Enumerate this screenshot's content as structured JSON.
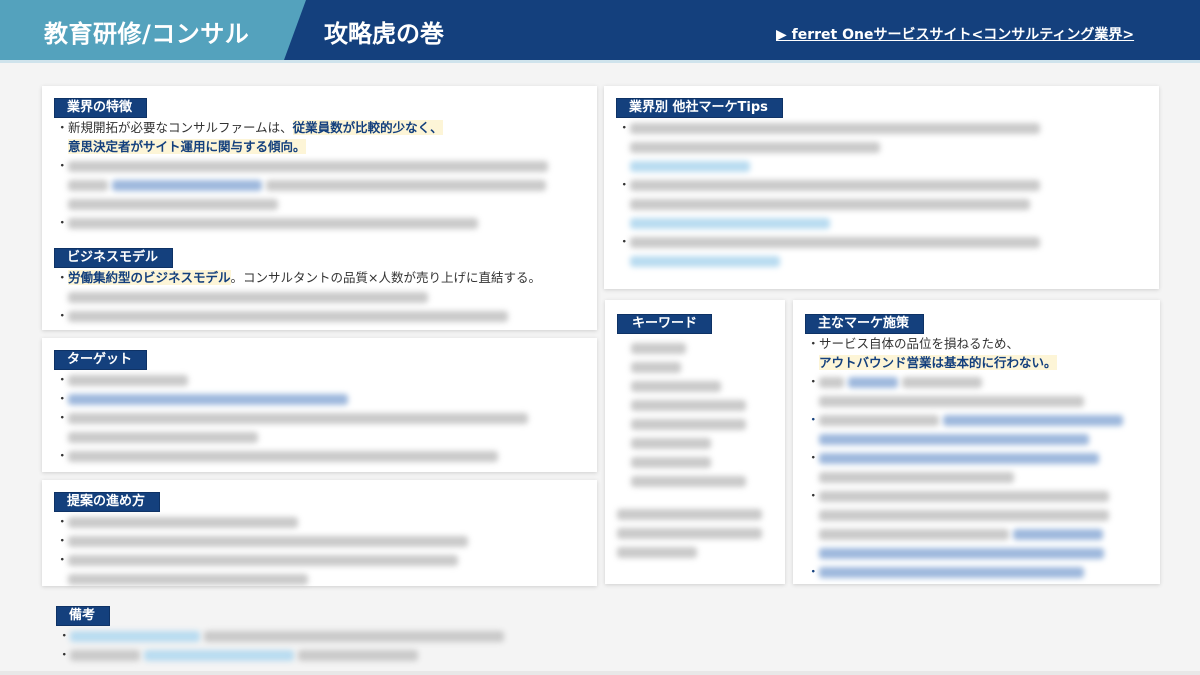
{
  "header": {
    "left_title": "教育研修/コンサル",
    "right_title": "攻略虎の巻",
    "link_label": "▶ ferret Oneサービスサイト<コンサルティング業界>"
  },
  "colors": {
    "navy": "#14407d",
    "teal": "#54a2bd",
    "highlight": "#fdf5d7"
  },
  "sections": {
    "industry": {
      "label": "業界の特徴",
      "item1_plain": "新規開拓が必要なコンサルファームは、",
      "item1_hl_a": "従業員数が比較的少なく、",
      "item1_hl_b": "意思決定者がサイト運用に関与する傾向。"
    },
    "business": {
      "label": "ビジネスモデル",
      "item1_hl": "労働集約型のビジネスモデル",
      "item1_plain": "。コンサルタントの品質×人数が売り上げに直結する。"
    },
    "target": {
      "label": "ターゲット"
    },
    "proposal": {
      "label": "提案の進め方"
    },
    "notes": {
      "label": "備考"
    },
    "tips": {
      "label": "業界別 他社マーケTips"
    },
    "keywords": {
      "label": "キーワード"
    },
    "measures": {
      "label": "主なマーケ施策",
      "item1_plain": "サービス自体の品位を損ねるため、",
      "item1_hl": "アウトバウンド営業は基本的に行わない。"
    }
  },
  "bullet": "・"
}
